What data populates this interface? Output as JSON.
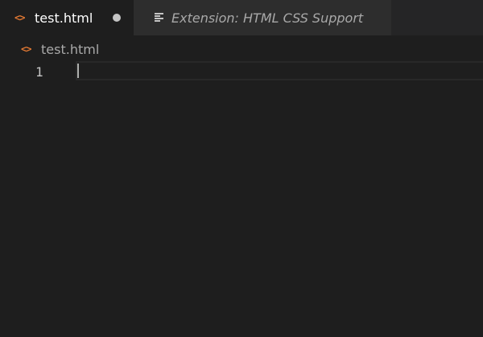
{
  "tabs": [
    {
      "label": "test.html",
      "icon": "code-icon",
      "active": true,
      "dirty": true
    },
    {
      "label": "Extension: HTML CSS Support",
      "icon": "preview-icon",
      "active": false,
      "preview": true
    }
  ],
  "breadcrumb": {
    "label": "test.html",
    "icon": "code-icon"
  },
  "editor": {
    "line_numbers": [
      "1"
    ],
    "lines": [
      ""
    ]
  },
  "colors": {
    "editor_background": "#1e1e1e",
    "tab_inactive_background": "#2d2d2d",
    "file_icon": "#e37933",
    "foreground": "#ffffff"
  }
}
